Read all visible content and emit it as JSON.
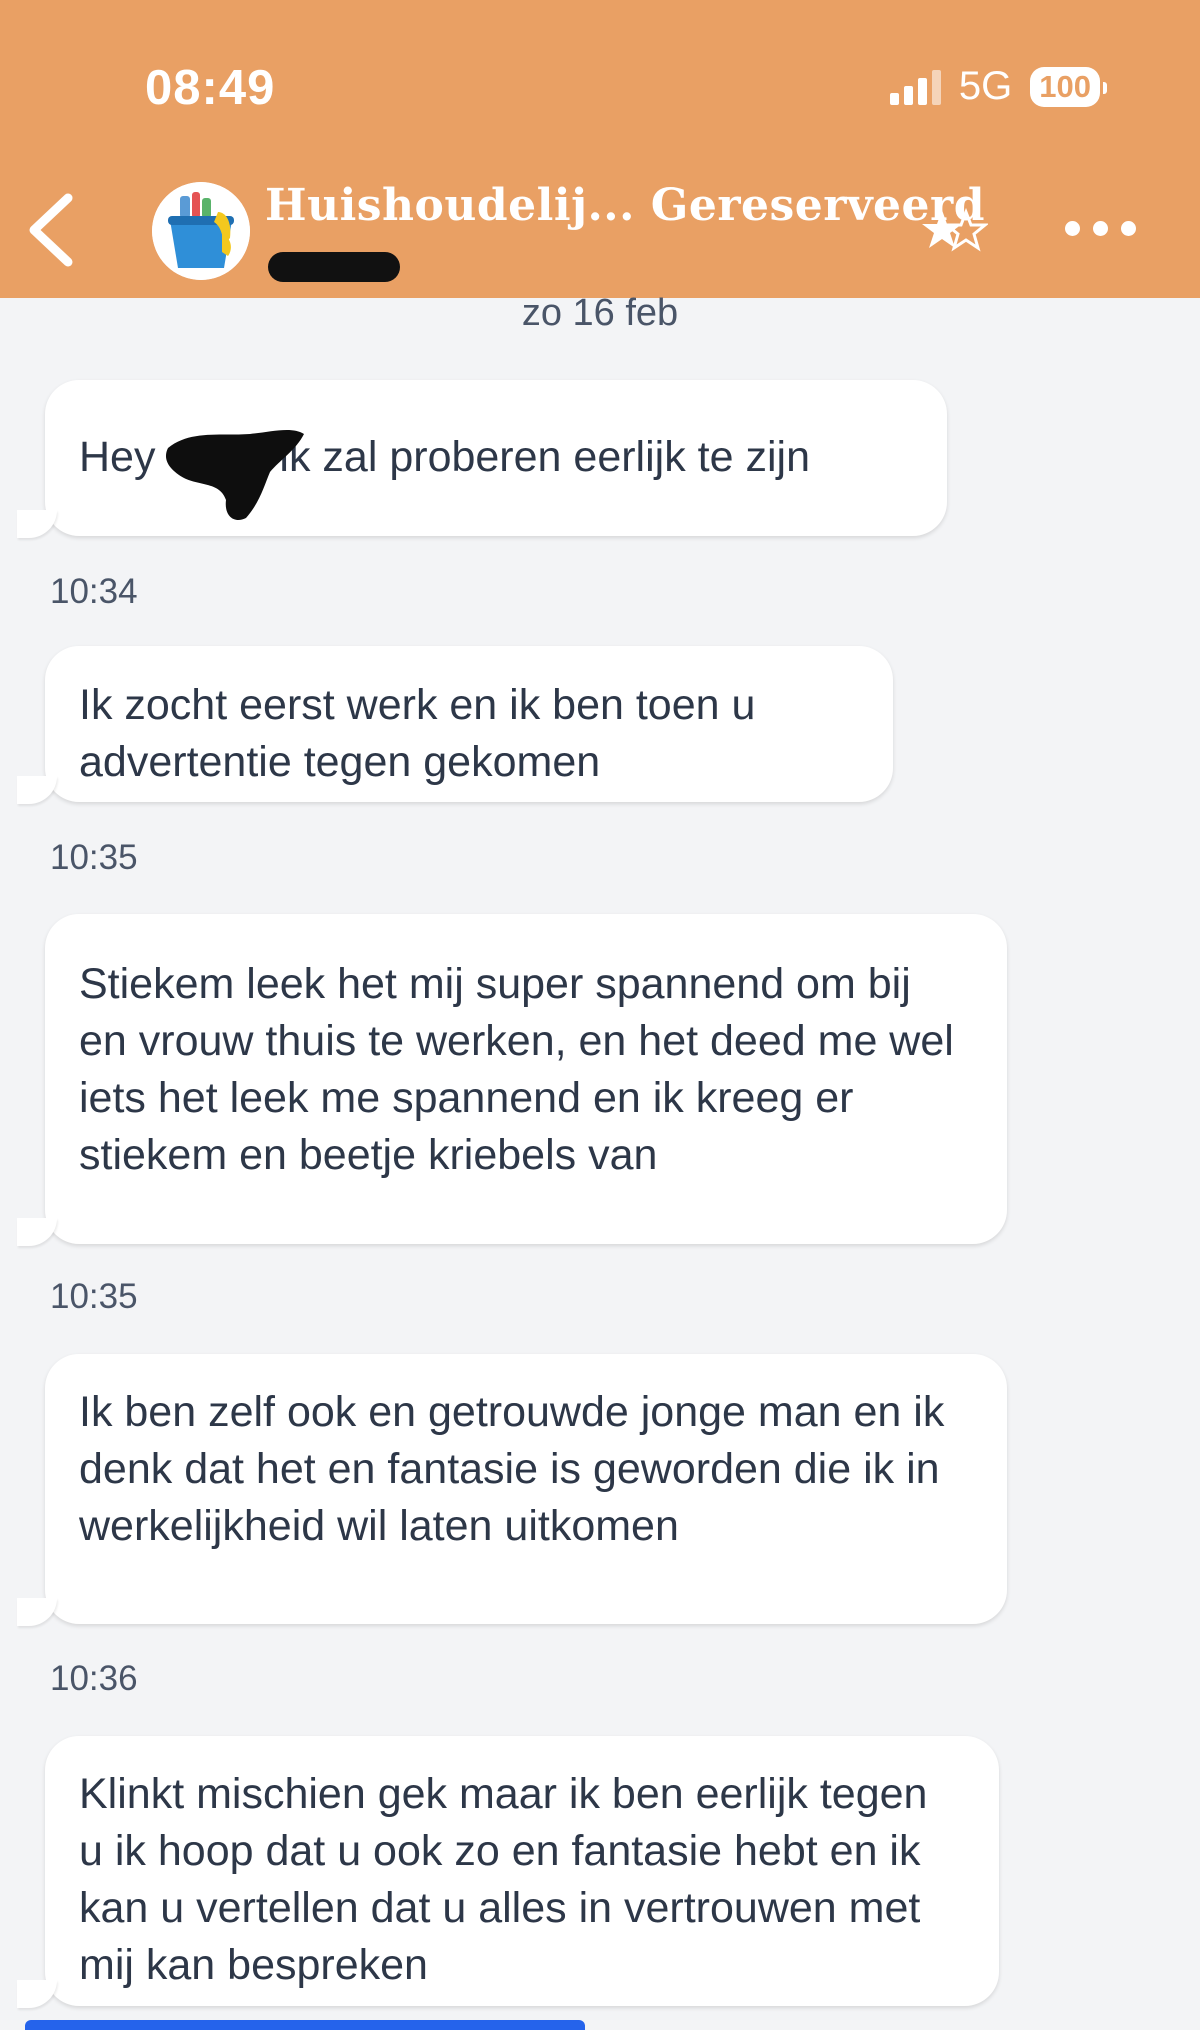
{
  "status_bar": {
    "time": "08:49",
    "network": "5G",
    "battery": "100"
  },
  "header": {
    "title": "Huishoudelij... Gereserveerd"
  },
  "date_separator": "zo 16 feb",
  "messages": [
    {
      "text_before": "Hey",
      "text_after": " ik zal proberen eerlijk te zijn",
      "time": "10:34"
    },
    {
      "text": "Ik zocht eerst werk en ik ben toen u advertentie tegen gekomen",
      "time": "10:35"
    },
    {
      "text": "Stiekem leek het mij super spannend om bij en vrouw thuis te werken, en het deed me wel iets het leek me spannend en ik kreeg er stiekem en beetje kriebels van",
      "time": "10:35"
    },
    {
      "text": "Ik ben zelf ook en getrouwde jonge man en ik denk dat het en fantasie is geworden die ik in werkelijkheid wil laten uitkomen",
      "time": "10:36"
    },
    {
      "text": "Klinkt mischien gek maar ik ben eerlijk tegen u ik hoop dat u ook zo en fantasie hebt en ik kan u vertellen dat u alles in vertrouwen met mij kan bespreken"
    }
  ],
  "colors": {
    "header": "#e9a064",
    "background": "#f3f4f6",
    "bubble": "#ffffff",
    "text": "#2d3748"
  },
  "icons": [
    "back-chevron-icon",
    "cleaning-bucket-avatar",
    "star-rating-icon",
    "more-options-icon",
    "signal-icon",
    "battery-icon"
  ]
}
